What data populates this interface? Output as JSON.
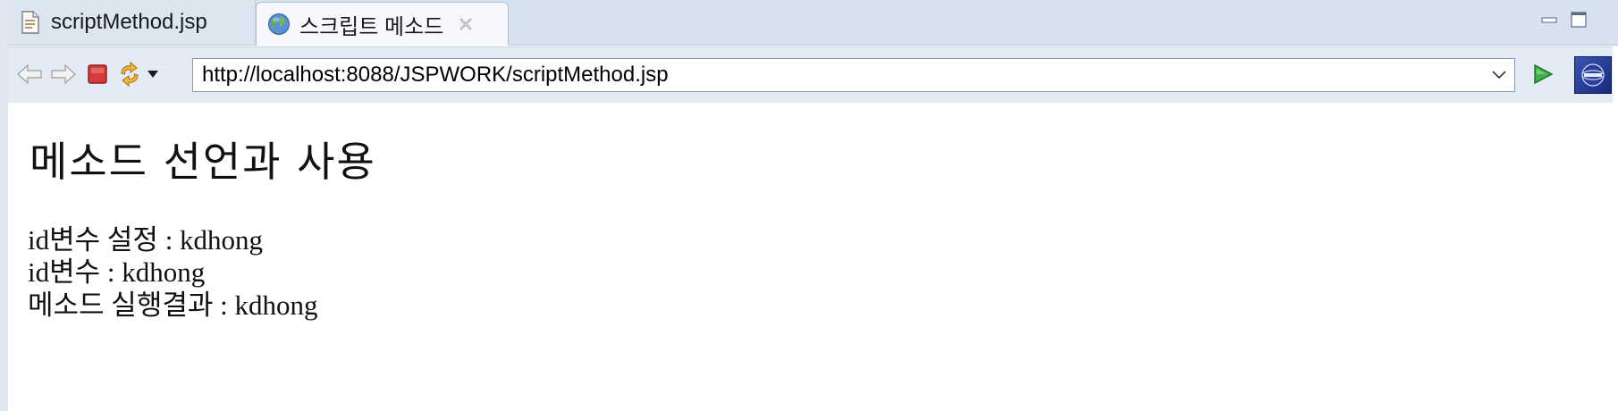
{
  "tabs": [
    {
      "label": "scriptMethod.jsp",
      "icon": "jsp-file-icon",
      "active": false
    },
    {
      "label": "스크립트 메소드",
      "icon": "globe-icon",
      "active": true
    }
  ],
  "toolbar": {
    "url": "http://localhost:8088/JSPWORK/scriptMethod.jsp"
  },
  "page": {
    "heading": "메소드 선언과 사용",
    "lines": [
      "id변수 설정 : kdhong",
      "id변수 : kdhong",
      "메소드 실행결과 : kdhong"
    ]
  },
  "colors": {
    "stop": "#d63a3a",
    "go": "#2e9e3a",
    "tabbar": "#d6e2ef",
    "toolbar": "#e3ebf5"
  }
}
